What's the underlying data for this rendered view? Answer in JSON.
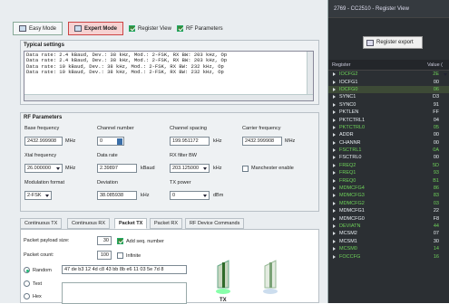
{
  "topbar": {
    "easy_mode": "Easy Mode",
    "expert_mode": "Expert Mode",
    "register_view": "Register View",
    "rf_parameters": "RF Parameters"
  },
  "typical": {
    "title": "Typical settings",
    "lines": [
      "Data rate: 2.4 kBaud, Dev.: 38 kHz, Mod.: 2-FSK, RX BW: 203 kHz, Op",
      "Data rate: 2.4 kBaud, Dev.: 38 kHz, Mod.: 2-FSK, RX BW: 203 kHz, Op",
      "Data rate: 10 kBaud, Dev.: 38 kHz, Mod.: 2-FSK, RX BW: 232 kHz, Op",
      "Data rate: 10 kBaud, Dev.: 38 kHz, Mod.: 2-FSK, RX BW: 232 kHz, Op"
    ]
  },
  "rf": {
    "title": "RF Parameters",
    "base_freq_label": "Base frequency",
    "base_freq": "2432.999908",
    "mhz": "MHz",
    "channel_number_label": "Channel number",
    "channel_number": "0",
    "channel_spacing_label": "Channel spacing",
    "channel_spacing": "199.951172",
    "khz": "kHz",
    "carrier_freq_label": "Carrier frequency",
    "carrier_freq": "2432.999908",
    "xtal_label": "Xtal frequency",
    "xtal": "26.000000",
    "data_rate_label": "Data rate",
    "data_rate": "2.39897",
    "kbaud": "kBaud",
    "rx_bw_label": "RX filter BW",
    "rx_bw": "203.125000",
    "manchester_label": "Manchester enable",
    "mod_label": "Modulation format",
    "mod": "2-FSK",
    "deviation_label": "Deviation",
    "deviation": "38.085938",
    "tx_power_label": "TX power",
    "tx_power": "0",
    "dbm": "dBm"
  },
  "tabs": [
    "Continuous TX",
    "Continuous RX",
    "Packet TX",
    "Packet RX",
    "RF Device Commands"
  ],
  "packet": {
    "payload_label": "Packet payload size:",
    "payload": "30",
    "add_seq": "Add seq. number",
    "count_label": "Packet count:",
    "count": "100",
    "infinite": "Infinite",
    "random": "Random",
    "random_data": "47 de b3 12 4d c8 43 bb 8b e6 11 03 5e 7d 8",
    "text": "Text",
    "hex": "Hex",
    "tx": "TX"
  },
  "register_view": {
    "title": "2769 - CC2510 - Register View",
    "export": "Register export",
    "col_register": "Register",
    "col_value": "Value (",
    "rows": [
      {
        "name": "IOCFG2",
        "value": "2E",
        "green": true
      },
      {
        "name": "IOCFG1",
        "value": "00",
        "green": false
      },
      {
        "name": "IOCFG0",
        "value": "06",
        "green": true,
        "selected": true
      },
      {
        "name": "SYNC1",
        "value": "D3",
        "green": false
      },
      {
        "name": "SYNC0",
        "value": "91",
        "green": false
      },
      {
        "name": "PKTLEN",
        "value": "FF",
        "green": false
      },
      {
        "name": "PKTCTRL1",
        "value": "04",
        "green": false
      },
      {
        "name": "PKTCTRL0",
        "value": "05",
        "green": true
      },
      {
        "name": "ADDR",
        "value": "00",
        "green": false
      },
      {
        "name": "CHANNR",
        "value": "00",
        "green": false
      },
      {
        "name": "FSCTRL1",
        "value": "0A",
        "green": true
      },
      {
        "name": "FSCTRL0",
        "value": "00",
        "green": false
      },
      {
        "name": "FREQ2",
        "value": "5D",
        "green": true
      },
      {
        "name": "FREQ1",
        "value": "93",
        "green": true
      },
      {
        "name": "FREQ0",
        "value": "B1",
        "green": true
      },
      {
        "name": "MDMCFG4",
        "value": "86",
        "green": true
      },
      {
        "name": "MDMCFG3",
        "value": "83",
        "green": true
      },
      {
        "name": "MDMCFG2",
        "value": "03",
        "green": true
      },
      {
        "name": "MDMCFG1",
        "value": "22",
        "green": false
      },
      {
        "name": "MDMCFG0",
        "value": "F8",
        "green": false
      },
      {
        "name": "DEVIATN",
        "value": "44",
        "green": true
      },
      {
        "name": "MCSM2",
        "value": "07",
        "green": false
      },
      {
        "name": "MCSM1",
        "value": "30",
        "green": false
      },
      {
        "name": "MCSM0",
        "value": "14",
        "green": true
      },
      {
        "name": "FOCCFG",
        "value": "16",
        "green": true
      }
    ]
  }
}
